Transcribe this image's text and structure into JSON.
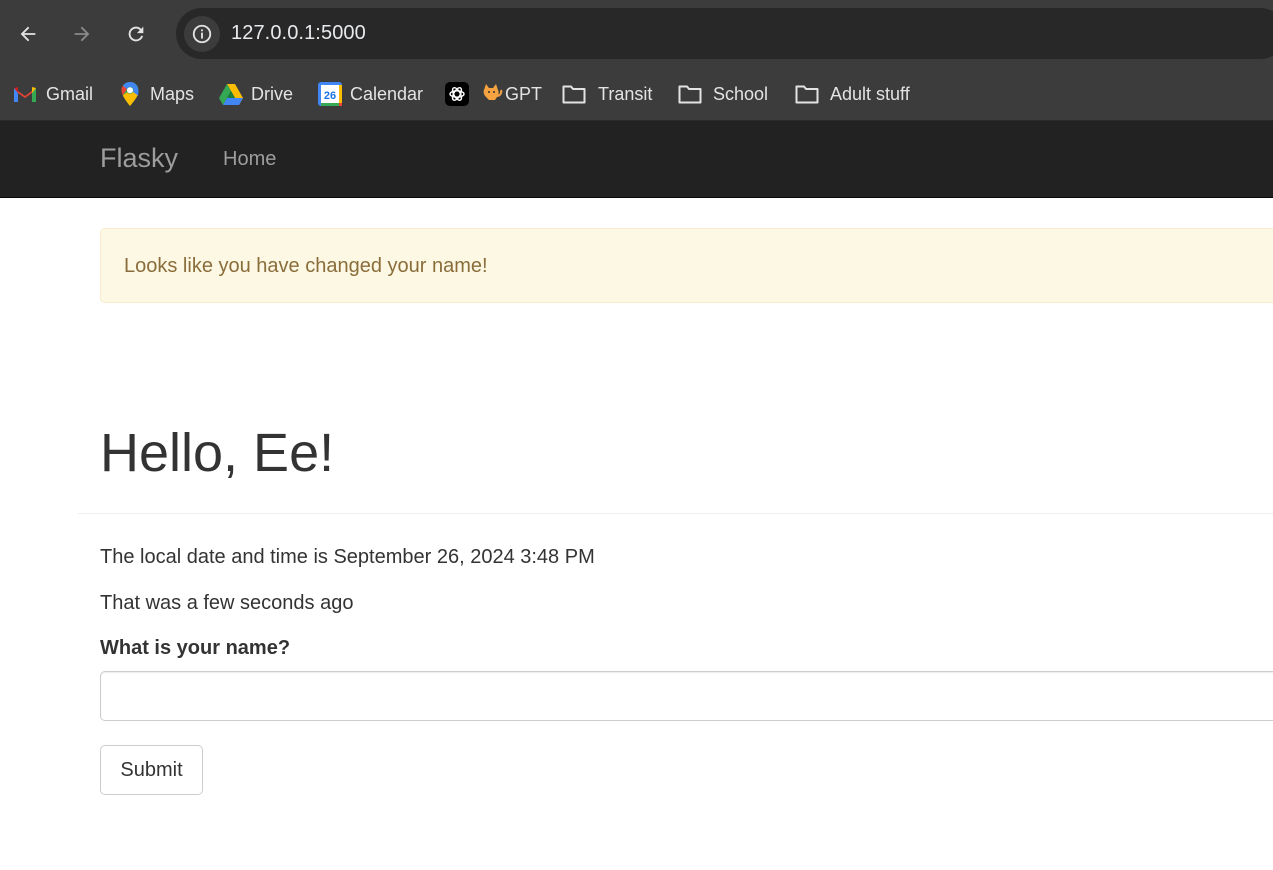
{
  "browser": {
    "url": "127.0.0.1:5000",
    "bookmarks": [
      {
        "label": "Gmail",
        "icon": "gmail-icon"
      },
      {
        "label": "Maps",
        "icon": "maps-icon"
      },
      {
        "label": "Drive",
        "icon": "drive-icon"
      },
      {
        "label": "Calendar",
        "icon": "calendar-icon",
        "badge": "26"
      },
      {
        "label": "GPT",
        "icon": "openai-icon"
      },
      {
        "label": "Transit",
        "icon": "folder-icon"
      },
      {
        "label": "School",
        "icon": "folder-icon"
      },
      {
        "label": "Adult stuff",
        "icon": "folder-icon"
      }
    ]
  },
  "navbar": {
    "brand": "Flasky",
    "links": [
      "Home"
    ]
  },
  "alert": {
    "message": "Looks like you have changed your name!"
  },
  "main": {
    "heading": "Hello, Ee!",
    "datetime_text": "The local date and time is September 26, 2024 3:48 PM",
    "relative_text": "That was a few seconds ago",
    "form": {
      "label": "What is your name?",
      "value": "",
      "submit_label": "Submit"
    }
  },
  "colors": {
    "chrome_bg": "#3c3c3c",
    "omnibox_bg": "#282828",
    "navbar_bg": "#222222",
    "alert_bg": "#fcf8e3",
    "alert_text": "#8a6d3b",
    "body_text": "#333333"
  }
}
